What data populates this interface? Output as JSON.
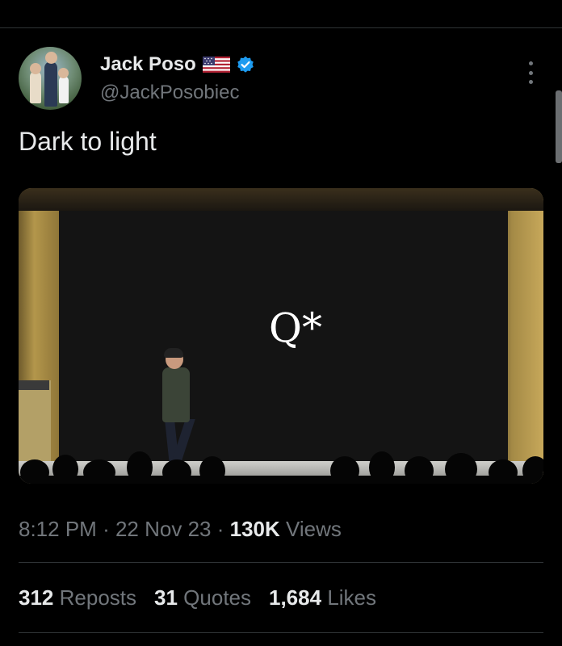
{
  "author": {
    "display_name": "Jack Poso",
    "handle": "@JackPosobiec",
    "flag_icon": "us-flag-icon",
    "verified_icon": "verified-badge-icon",
    "verified_color": "#1d9bf0"
  },
  "tweet": {
    "text": "Dark to light",
    "media_text": "Q*"
  },
  "meta": {
    "time": "8:12 PM",
    "date": "22 Nov 23",
    "views_count": "130K",
    "views_label": "Views",
    "separator": "·"
  },
  "stats": {
    "reposts_count": "312",
    "reposts_label": "Reposts",
    "quotes_count": "31",
    "quotes_label": "Quotes",
    "likes_count": "1,684",
    "likes_label": "Likes"
  },
  "colors": {
    "background": "#000000",
    "text_primary": "#e7e9ea",
    "text_secondary": "#71767b",
    "divider": "#2f3336"
  }
}
